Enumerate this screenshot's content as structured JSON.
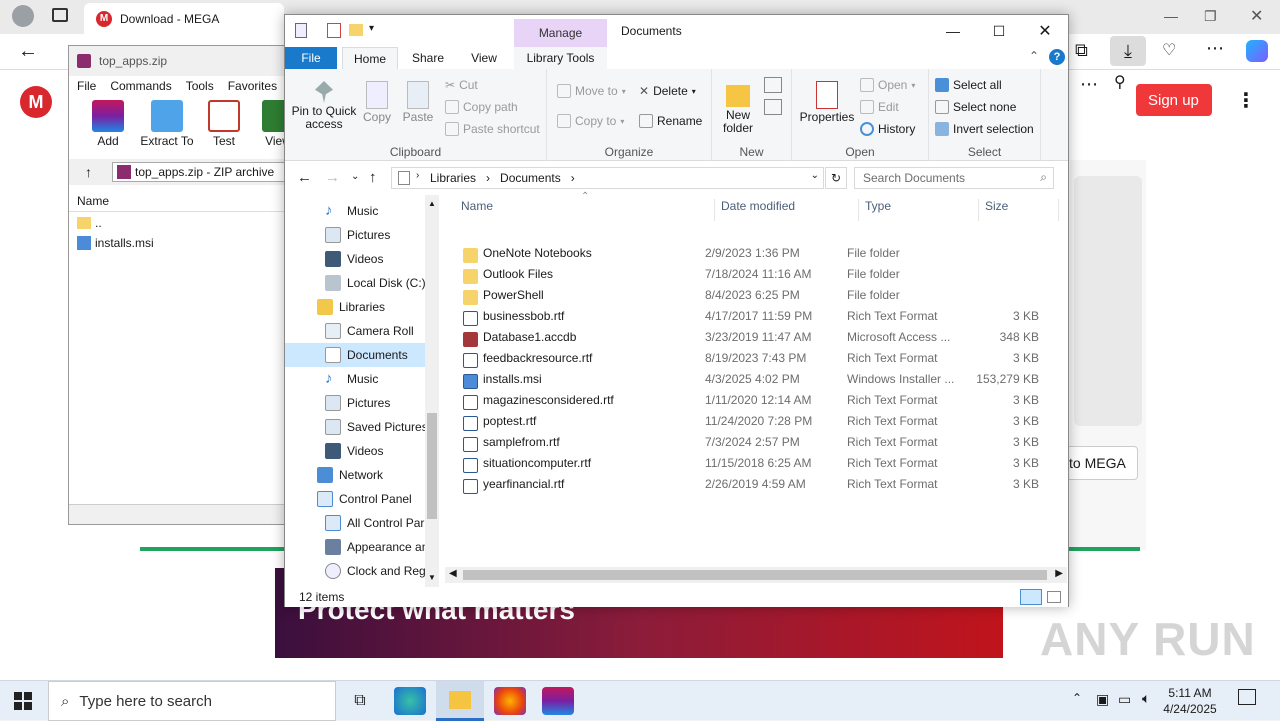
{
  "browser": {
    "tab_title": "Download - MEGA",
    "signup": "Sign up",
    "to_mega": "to MEGA",
    "banner": "Protect what matters",
    "watermark": "ANY RUN"
  },
  "winrar": {
    "title": "top_apps.zip",
    "menu": [
      "File",
      "Commands",
      "Tools",
      "Favorites"
    ],
    "toolbar": [
      "Add",
      "Extract To",
      "Test",
      "View"
    ],
    "path": "top_apps.zip - ZIP archive",
    "col_name": "Name",
    "items": [
      "..",
      "installs.msi"
    ]
  },
  "explorer": {
    "title": "Documents",
    "manage": "Manage",
    "ribbon_tabs": {
      "file": "File",
      "home": "Home",
      "share": "Share",
      "view": "View",
      "library_tools": "Library Tools"
    },
    "clipboard": {
      "label": "Clipboard",
      "pin": "Pin to Quick access",
      "copy": "Copy",
      "paste": "Paste",
      "cut": "Cut",
      "copy_path": "Copy path",
      "paste_shortcut": "Paste shortcut"
    },
    "organize": {
      "label": "Organize",
      "move_to": "Move to",
      "copy_to": "Copy to",
      "delete": "Delete",
      "rename": "Rename"
    },
    "new": {
      "label": "New",
      "new_folder": "New folder"
    },
    "open": {
      "label": "Open",
      "properties": "Properties",
      "open": "Open",
      "edit": "Edit",
      "history": "History"
    },
    "select": {
      "label": "Select",
      "select_all": "Select all",
      "select_none": "Select none",
      "invert": "Invert selection"
    },
    "breadcrumb": [
      "Libraries",
      "Documents"
    ],
    "search_placeholder": "Search Documents",
    "nav": [
      "Music",
      "Pictures",
      "Videos",
      "Local Disk (C:)",
      "Libraries",
      "Camera Roll",
      "Documents",
      "Music",
      "Pictures",
      "Saved Pictures",
      "Videos",
      "Network",
      "Control Panel",
      "All Control Par",
      "Appearance an",
      "Clock and Regi"
    ],
    "columns": {
      "name": "Name",
      "date": "Date modified",
      "type": "Type",
      "size": "Size"
    },
    "files": [
      {
        "name": "OneNote Notebooks",
        "date": "2/9/2023 1:36 PM",
        "type": "File folder",
        "size": "",
        "icon": "folder"
      },
      {
        "name": "Outlook Files",
        "date": "7/18/2024 11:16 AM",
        "type": "File folder",
        "size": "",
        "icon": "folder"
      },
      {
        "name": "PowerShell",
        "date": "8/4/2023 6:25 PM",
        "type": "File folder",
        "size": "",
        "icon": "folder"
      },
      {
        "name": "businessbob.rtf",
        "date": "4/17/2017 11:59 PM",
        "type": "Rich Text Format",
        "size": "3 KB",
        "icon": "rtf"
      },
      {
        "name": "Database1.accdb",
        "date": "3/23/2019 11:47 AM",
        "type": "Microsoft Access ...",
        "size": "348 KB",
        "icon": "access"
      },
      {
        "name": "feedbackresource.rtf",
        "date": "8/19/2023 7:43 PM",
        "type": "Rich Text Format",
        "size": "3 KB",
        "icon": "rtf"
      },
      {
        "name": "installs.msi",
        "date": "4/3/2025 4:02 PM",
        "type": "Windows Installer ...",
        "size": "153,279 KB",
        "icon": "msi"
      },
      {
        "name": "magazinesconsidered.rtf",
        "date": "1/11/2020 12:14 AM",
        "type": "Rich Text Format",
        "size": "3 KB",
        "icon": "rtf"
      },
      {
        "name": "poptest.rtf",
        "date": "11/24/2020 7:28 PM",
        "type": "Rich Text Format",
        "size": "3 KB",
        "icon": "rtf"
      },
      {
        "name": "samplefrom.rtf",
        "date": "7/3/2024 2:57 PM",
        "type": "Rich Text Format",
        "size": "3 KB",
        "icon": "rtf"
      },
      {
        "name": "situationcomputer.rtf",
        "date": "11/15/2018 6:25 AM",
        "type": "Rich Text Format",
        "size": "3 KB",
        "icon": "rtf"
      },
      {
        "name": "yearfinancial.rtf",
        "date": "2/26/2019 4:59 AM",
        "type": "Rich Text Format",
        "size": "3 KB",
        "icon": "rtf"
      }
    ],
    "status": "12 items"
  },
  "taskbar": {
    "search_placeholder": "Type here to search",
    "time": "5:11 AM",
    "date": "4/24/2025"
  }
}
